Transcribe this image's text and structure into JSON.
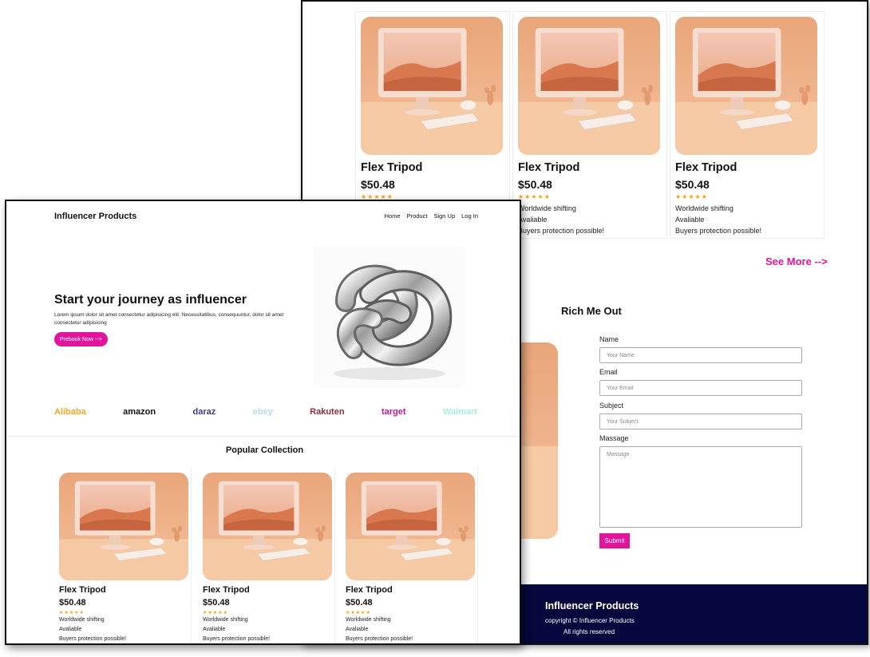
{
  "brand": "Influencer Products",
  "nav": [
    "Home",
    "Product",
    "Sign Up",
    "Log In"
  ],
  "hero": {
    "title": "Start your journey as influencer",
    "subtitle": "Lorem ipsum dolor sit amet consectetur adipisicing elit. Necessitatibus, consequuntur, dolor sit amet consectetur adipisicing",
    "cta": "Prebook Now -->"
  },
  "partners": [
    {
      "name": "Alibaba",
      "color": "#f5a623"
    },
    {
      "name": "amazon",
      "color": "#111111"
    },
    {
      "name": "daraz",
      "color": "#3d3a8c"
    },
    {
      "name": "ebey",
      "color": "#b7dde6"
    },
    {
      "name": "Rakuten",
      "color": "#8e2b3f"
    },
    {
      "name": "target",
      "color": "#c2188f"
    },
    {
      "name": "Walmart",
      "color": "#a7ece0"
    }
  ],
  "collection": {
    "title": "Popular Collection",
    "products": [
      {
        "name": "Flex Tripod",
        "price": "$50.48",
        "stars": "★★★★★",
        "features": [
          "Worldwide shifting",
          "Avaliable",
          "Buyers protection possible!"
        ]
      },
      {
        "name": "Flex Tripod",
        "price": "$50.48",
        "stars": "★★★★★",
        "features": [
          "Worldwide shifting",
          "Avaliable",
          "Buyers protection possible!"
        ]
      },
      {
        "name": "Flex Tripod",
        "price": "$50.48",
        "stars": "★★★★★",
        "features": [
          "Worldwide shifting",
          "Avaliable",
          "Buyers protection possible!"
        ]
      }
    ],
    "see_more": "See More -->"
  },
  "contact": {
    "title": "Rich Me Out",
    "name_label": "Name",
    "name_placeholder": "Your Name",
    "email_label": "Email",
    "email_placeholder": "Your Email",
    "subject_label": "Subject",
    "subject_placeholder": "Your Subject",
    "message_label": "Massage",
    "message_placeholder": "Massage",
    "submit": "Submit"
  },
  "footer": {
    "title": "Influencer Products",
    "copyright": "copyright © Influencer Products",
    "rights": "All rights reserved"
  },
  "colors": {
    "accent": "#e0159b",
    "footer_bg": "#07073e",
    "stars": "#f0a21b"
  },
  "icons": [
    "computer-desk-illustration",
    "chrome-knot-illustration"
  ]
}
